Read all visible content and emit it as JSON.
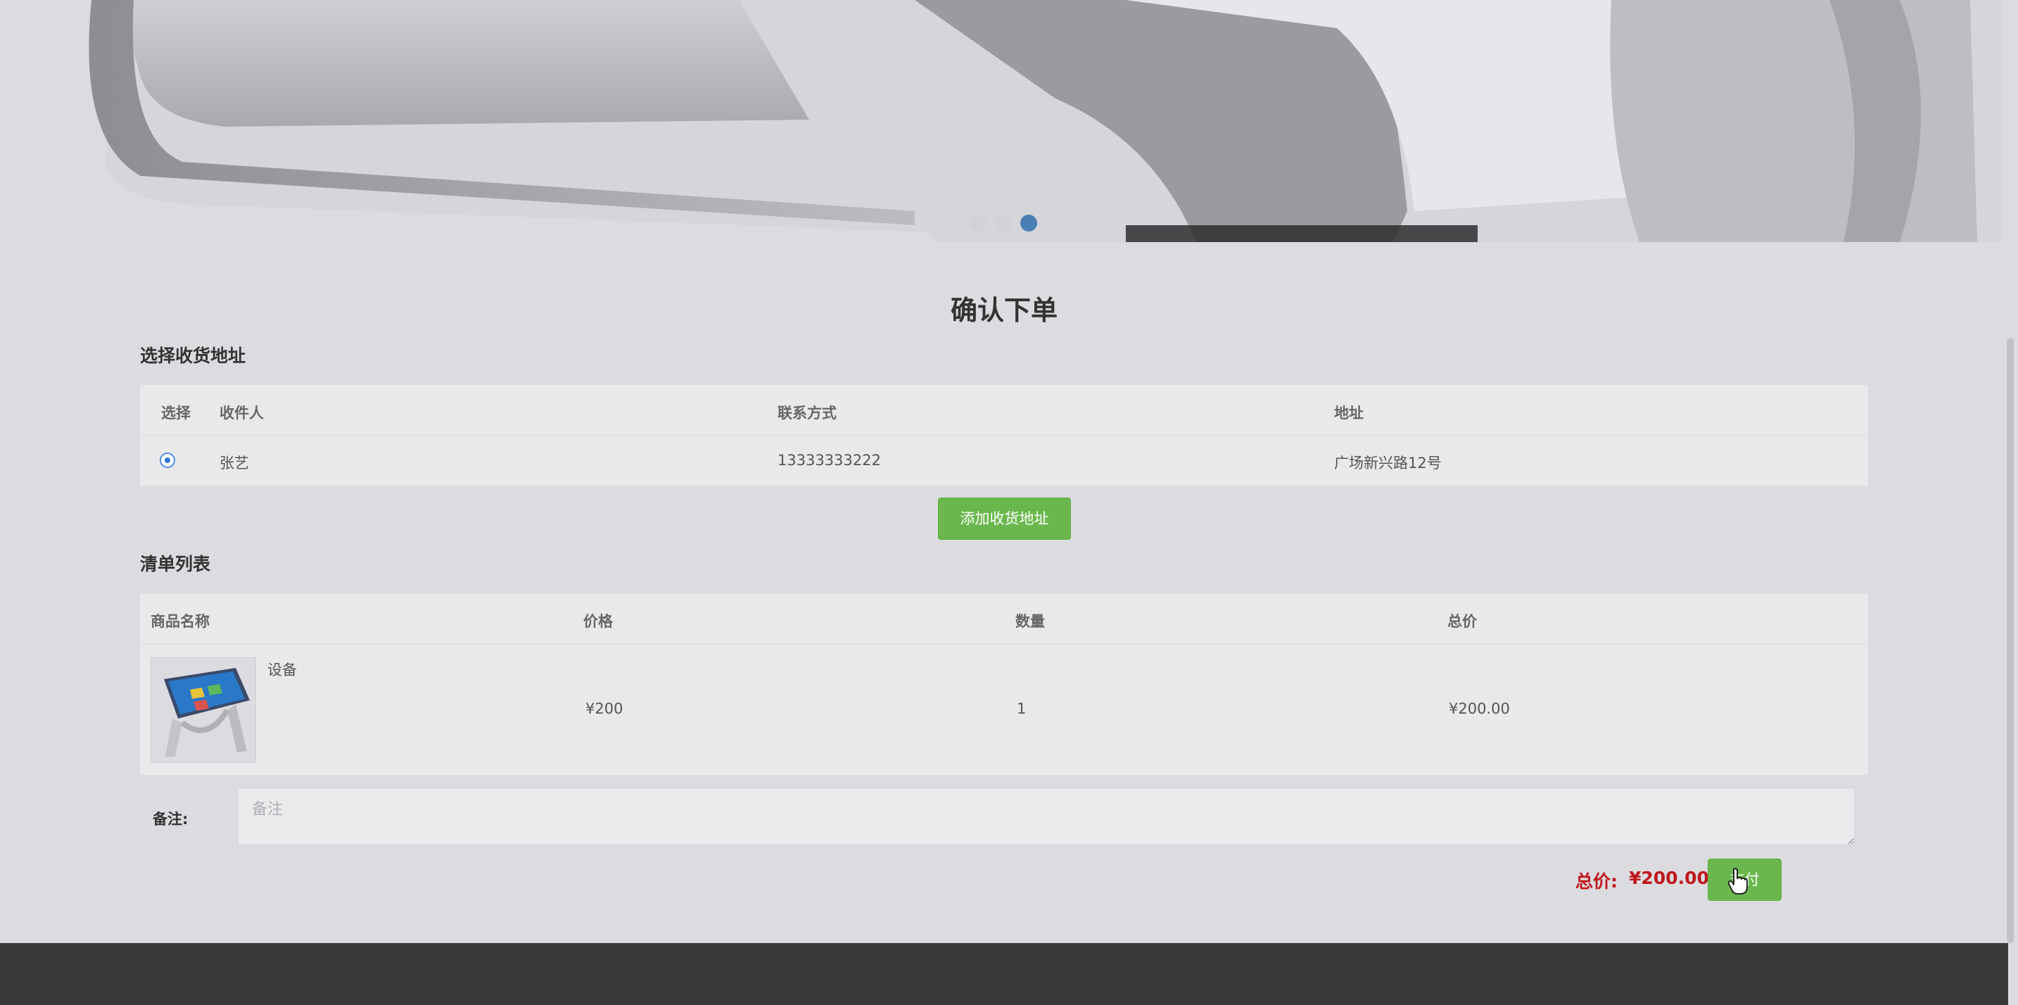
{
  "banner": {
    "dots": [
      {
        "active": false
      },
      {
        "active": false
      },
      {
        "active": true
      }
    ]
  },
  "page_title": "确认下单",
  "address_section": {
    "title": "选择收货地址",
    "headers": {
      "select": "选择",
      "recipient": "收件人",
      "contact": "联系方式",
      "address": "地址"
    },
    "rows": [
      {
        "selected": true,
        "recipient": "张艺",
        "contact": "13333333222",
        "address": "广场新兴路12号"
      }
    ],
    "add_button": "添加收货地址"
  },
  "order_section": {
    "title": "清单列表",
    "headers": {
      "name": "商品名称",
      "price": "价格",
      "qty": "数量",
      "total": "总价"
    },
    "items": [
      {
        "name": "设备",
        "price": "¥200",
        "qty": "1",
        "total": "¥200.00"
      }
    ]
  },
  "remark": {
    "label": "备注:",
    "placeholder": "备注",
    "value": ""
  },
  "summary": {
    "total_label": "总价:",
    "total_value": "¥200.00",
    "pay_button": "支付"
  },
  "colors": {
    "accent_green": "#6ab84d",
    "price_red": "#c0171c",
    "footer": "#3a3a3c",
    "active_dot": "#4a7fb5"
  }
}
